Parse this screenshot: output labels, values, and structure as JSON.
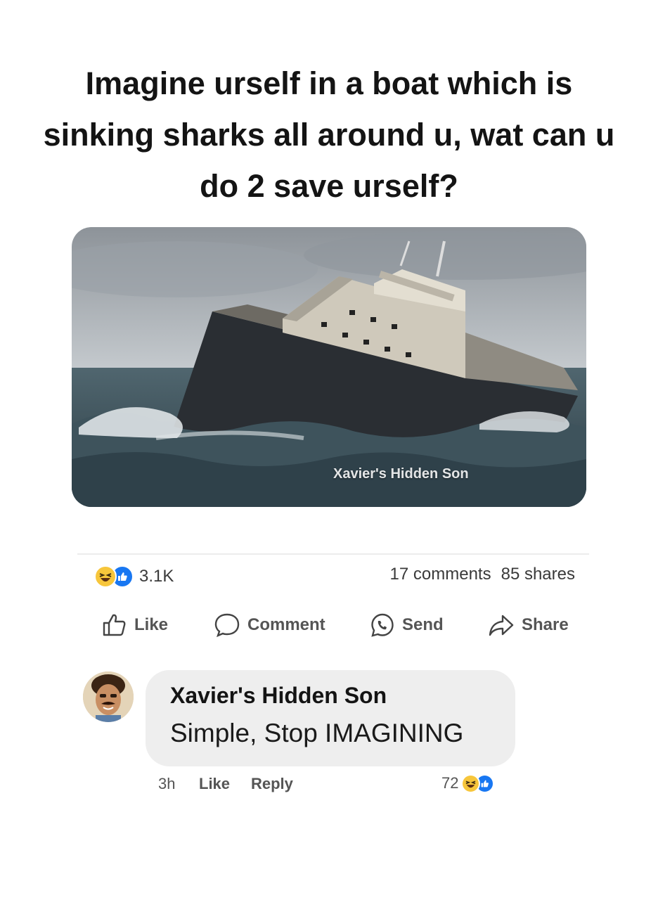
{
  "post": {
    "text": "Imagine urself in a boat which is sinking sharks all around u, wat can u do 2 save urself?",
    "image": {
      "subject": "sinking-ship-in-stormy-sea",
      "watermark": "Xavier's Hidden Son"
    }
  },
  "stats": {
    "reactions_count": "3.1K",
    "reaction_types": [
      "haha",
      "like"
    ],
    "comments": "17 comments",
    "shares": "85 shares"
  },
  "actions": {
    "like": "Like",
    "comment": "Comment",
    "send": "Send",
    "share": "Share"
  },
  "comment": {
    "author": "Xavier's Hidden Son",
    "text": "Simple, Stop IMAGINING",
    "time": "3h",
    "like_label": "Like",
    "reply_label": "Reply",
    "reaction_count": "72"
  },
  "colors": {
    "like_blue": "#1877f2",
    "haha_yellow": "#f7c63b",
    "bubble_bg": "#eeeeee"
  }
}
